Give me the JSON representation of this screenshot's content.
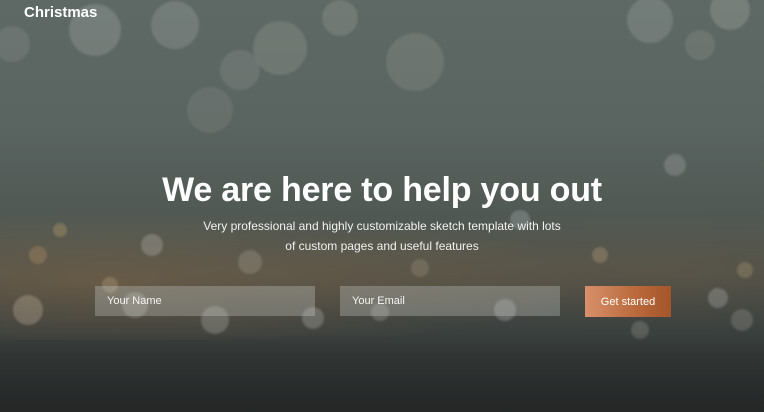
{
  "brand": {
    "name": "Christmas"
  },
  "hero": {
    "title": "We are here to help you out",
    "subtitle_line1": "Very professional and highly customizable sketch template with lots",
    "subtitle_line2": "of custom pages and useful features"
  },
  "form": {
    "name_placeholder": "Your Name",
    "email_placeholder": "Your Email",
    "submit_label": "Get started"
  },
  "colors": {
    "button_gradient_start": "#d8906a",
    "button_gradient_end": "#a4552a",
    "text": "#ffffff"
  }
}
